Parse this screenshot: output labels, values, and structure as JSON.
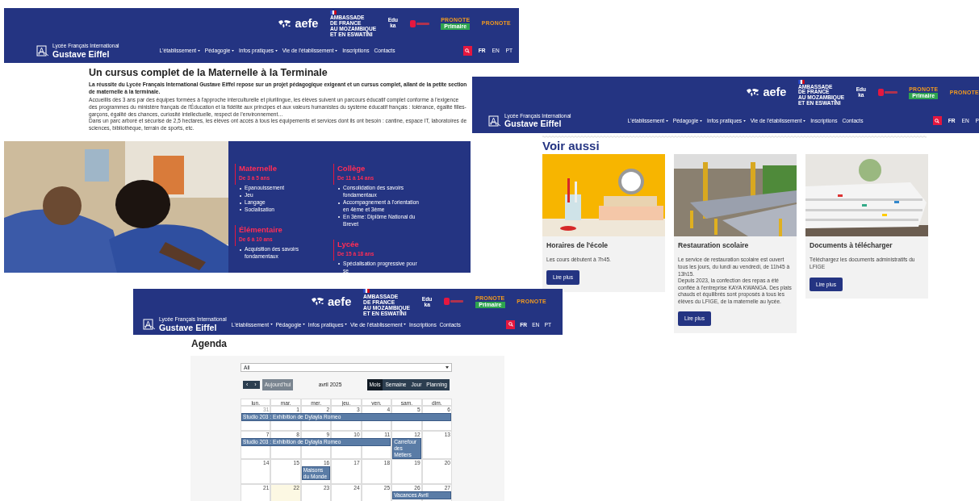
{
  "screenshots": [
    {
      "kind": "cursus",
      "header": {
        "aefe": {
          "word": "aefe"
        },
        "embassy": {
          "lines": [
            "AMBASSADE",
            "DE FRANCE",
            "AU MOZAMBIQUE",
            "ET EN ESWATINI"
          ]
        },
        "eduka": [
          "Edu",
          "ka"
        ],
        "pronote_primaire": {
          "brand": "PRONOTE",
          "label": "Primaire"
        },
        "pronote": "PRONOTE",
        "school": {
          "line1": "Lycée Français International",
          "line2": "Gustave Eiffel"
        },
        "menu": [
          {
            "label": "L'établissement",
            "dropdown": true
          },
          {
            "label": "Pédagogie",
            "dropdown": true
          },
          {
            "label": "Infos pratiques",
            "dropdown": true
          },
          {
            "label": "Vie de l'établissement",
            "dropdown": true
          },
          {
            "label": "Inscriptions",
            "dropdown": false
          },
          {
            "label": "Contacts",
            "dropdown": false
          }
        ],
        "languages": [
          {
            "code": "FR",
            "selected": true
          },
          {
            "code": "EN",
            "selected": false
          },
          {
            "code": "PT",
            "selected": false
          }
        ]
      },
      "heading": "Un cursus complet de la Maternelle à la Terminale",
      "lead": "La réussite du Lycée Français International Gustave Eiffel repose sur un projet pédagogique exigeant et un cursus complet, allant de la petite section de maternelle à la terminale.",
      "paragraphs": [
        "Accueillis dès 3 ans par des équipes formées à l'approche interculturelle et plurilingue, les élèves suivent un parcours éducatif complet conforme à l'exigence des programmes du ministère français de l'Éducation et la fidélité aux principes et aux valeurs humanistes du système éducatif français : tolérance, égalité filles-garçons, égalité des chances, curiosité intellectuelle, respect de l'environnement…",
        "Dans un parc arboré et sécurisé de 2,5 hectares, les élèves ont accès à tous les équipements et services dont ils ont besoin : cantine, espace IT, laboratoires de sciences, bibliothèque, terrain de sports, etc."
      ],
      "level_columns": [
        [
          {
            "title": "Maternelle",
            "ages": "De 3 à 5 ans",
            "items": [
              "Epanouissement",
              "Jeu",
              "Langage",
              "Socialisation"
            ]
          },
          {
            "title": "Élémentaire",
            "ages": "De 6 à 10 ans",
            "items": [
              "Acquisition des savoirs fondamentaux"
            ]
          }
        ],
        [
          {
            "title": "Collège",
            "ages": "De 11 à 14 ans",
            "items": [
              "Consolidation des savoirs fondamentaux",
              "Accompagnement à l'orientation en 4ème et 3ème",
              "En 3ème: Diplôme National du Brevet"
            ]
          },
          {
            "title": "Lycée",
            "ages": "De 15 à 18 ans",
            "items": [
              "Spécialisation progressive pour se"
            ]
          }
        ]
      ]
    },
    {
      "kind": "see-also",
      "header": {
        "aefe": {
          "word": "aefe"
        },
        "embassy": {
          "lines": [
            "AMBASSADE",
            "DE FRANCE",
            "AU MOZAMBIQUE",
            "ET EN ESWATINI"
          ]
        },
        "eduka": [
          "Edu",
          "ka"
        ],
        "pronote_primaire": {
          "brand": "PRONOTE",
          "label": "Primaire"
        },
        "pronote": "PRONOTE",
        "school": {
          "line1": "Lycée Français International",
          "line2": "Gustave Eiffel"
        },
        "menu": [
          {
            "label": "L'établissement",
            "dropdown": true
          },
          {
            "label": "Pédagogie",
            "dropdown": true
          },
          {
            "label": "Infos pratiques",
            "dropdown": true
          },
          {
            "label": "Vie de l'établissement",
            "dropdown": true
          },
          {
            "label": "Inscriptions",
            "dropdown": false
          },
          {
            "label": "Contacts",
            "dropdown": false
          }
        ],
        "languages": [
          {
            "code": "FR",
            "selected": true
          },
          {
            "code": "EN",
            "selected": false
          },
          {
            "code": "P",
            "selected": false
          }
        ]
      },
      "heading": "Voir aussi",
      "cards": [
        {
          "title": "Horaires de l'école",
          "text": [
            "Les cours débutent à 7h45."
          ],
          "button": "Lire plus"
        },
        {
          "title": "Restauration scolaire",
          "text": [
            "Le service de restauration scolaire est ouvert tous les jours, du lundi au vendredi, de 11h45 à 13h15.",
            "Depuis 2023, la confection des repas a été confiée à l'entreprise KAYA KWANGA. Des plats chauds et équilibrés sont proposés à tous les élèves du LFIGE, de la maternelle au lycée."
          ],
          "button": "Lire plus"
        },
        {
          "title": "Documents à télécharger",
          "text": [
            "Téléchargez les documents administratifs du LFIGE"
          ],
          "button": "Lire plus"
        }
      ]
    },
    {
      "kind": "agenda",
      "header": {
        "aefe": {
          "word": "aefe"
        },
        "embassy": {
          "lines": [
            "AMBASSADE",
            "DE FRANCE",
            "AU MOZAMBIQUE",
            "ET EN ESWATINI"
          ]
        },
        "eduka": [
          "Edu",
          "ka"
        ],
        "pronote_primaire": {
          "brand": "PRONOTE",
          "label": "Primaire"
        },
        "pronote": "PRONOTE",
        "school": {
          "line1": "Lycée Français International",
          "line2": "Gustave Eiffel"
        },
        "menu": [
          {
            "label": "L'établissement",
            "dropdown": true
          },
          {
            "label": "Pédagogie",
            "dropdown": true
          },
          {
            "label": "Infos pratiques",
            "dropdown": true
          },
          {
            "label": "Vie de l'établissement",
            "dropdown": true
          },
          {
            "label": "Inscriptions",
            "dropdown": false
          },
          {
            "label": "Contacts",
            "dropdown": false
          }
        ],
        "languages": [
          {
            "code": "FR",
            "selected": true
          },
          {
            "code": "EN",
            "selected": false
          },
          {
            "code": "PT",
            "selected": false
          }
        ]
      },
      "heading": "Agenda",
      "filter": "All",
      "nav_buttons": [
        "‹",
        "›"
      ],
      "today_button": "Aujourd'hui",
      "month": "avril 2025",
      "views": [
        {
          "label": "Mois",
          "selected": true
        },
        {
          "label": "Semaine",
          "selected": false
        },
        {
          "label": "Jour",
          "selected": false
        },
        {
          "label": "Planning",
          "selected": false
        }
      ],
      "weekdays": [
        "lun.",
        "mar.",
        "mer.",
        "jeu.",
        "ven.",
        "sam.",
        "dim."
      ],
      "weeks": [
        {
          "days": [
            {
              "label": "31",
              "other_month": true,
              "today": false
            },
            {
              "label": "1",
              "other_month": false,
              "today": false
            },
            {
              "label": "2",
              "other_month": false,
              "today": false
            },
            {
              "label": "3",
              "other_month": false,
              "today": false
            },
            {
              "label": "4",
              "other_month": false,
              "today": false
            },
            {
              "label": "5",
              "other_month": false,
              "today": false
            },
            {
              "label": "6",
              "other_month": false,
              "today": false
            }
          ],
          "lanes": [
            [
              {
                "kind": "start",
                "title": "Studio 203 : Exhibition de Dylayla Romeo"
              },
              {
                "kind": "continue"
              },
              {
                "kind": "continue"
              },
              {
                "kind": "continue"
              },
              {
                "kind": "continue"
              },
              {
                "kind": "continue"
              },
              {
                "kind": "continue"
              }
            ]
          ]
        },
        {
          "days": [
            {
              "label": "7",
              "other_month": false,
              "today": false
            },
            {
              "label": "8",
              "other_month": false,
              "today": false
            },
            {
              "label": "9",
              "other_month": false,
              "today": false
            },
            {
              "label": "10",
              "other_month": false,
              "today": false
            },
            {
              "label": "11",
              "other_month": false,
              "today": false
            },
            {
              "label": "12",
              "other_month": false,
              "today": false
            },
            {
              "label": "13",
              "other_month": false,
              "today": false
            }
          ],
          "lanes": [
            [
              {
                "kind": "start",
                "title": "Studio 203 : Exhibition de Dylayla Romeo"
              },
              {
                "kind": "continue"
              },
              {
                "kind": "continue"
              },
              {
                "kind": "continue"
              },
              {
                "kind": "continue"
              },
              {
                "kind": "start",
                "title": "Carrefour des Métiers"
              },
              {
                "kind": "empty"
              }
            ]
          ]
        },
        {
          "days": [
            {
              "label": "14",
              "other_month": false,
              "today": false
            },
            {
              "label": "15",
              "other_month": false,
              "today": false
            },
            {
              "label": "16",
              "other_month": false,
              "today": false
            },
            {
              "label": "17",
              "other_month": false,
              "today": false
            },
            {
              "label": "18",
              "other_month": false,
              "today": false
            },
            {
              "label": "19",
              "other_month": false,
              "today": false
            },
            {
              "label": "20",
              "other_month": false,
              "today": false
            }
          ],
          "lanes": [
            [
              {
                "kind": "empty"
              },
              {
                "kind": "empty"
              },
              {
                "kind": "start",
                "title": "Maisons du Monde"
              },
              {
                "kind": "empty"
              },
              {
                "kind": "empty"
              },
              {
                "kind": "empty"
              },
              {
                "kind": "empty"
              }
            ]
          ]
        },
        {
          "days": [
            {
              "label": "21",
              "other_month": false,
              "today": false
            },
            {
              "label": "22",
              "other_month": false,
              "today": true
            },
            {
              "label": "23",
              "other_month": false,
              "today": false
            },
            {
              "label": "24",
              "other_month": false,
              "today": false
            },
            {
              "label": "25",
              "other_month": false,
              "today": false
            },
            {
              "label": "26",
              "other_month": false,
              "today": false
            },
            {
              "label": "27",
              "other_month": false,
              "today": false
            }
          ],
          "lanes": [
            [
              {
                "kind": "empty"
              },
              {
                "kind": "empty"
              },
              {
                "kind": "empty"
              },
              {
                "kind": "empty"
              },
              {
                "kind": "empty"
              },
              {
                "kind": "start",
                "title": "Vacances Avril"
              },
              {
                "kind": "continue"
              }
            ]
          ]
        }
      ]
    }
  ]
}
